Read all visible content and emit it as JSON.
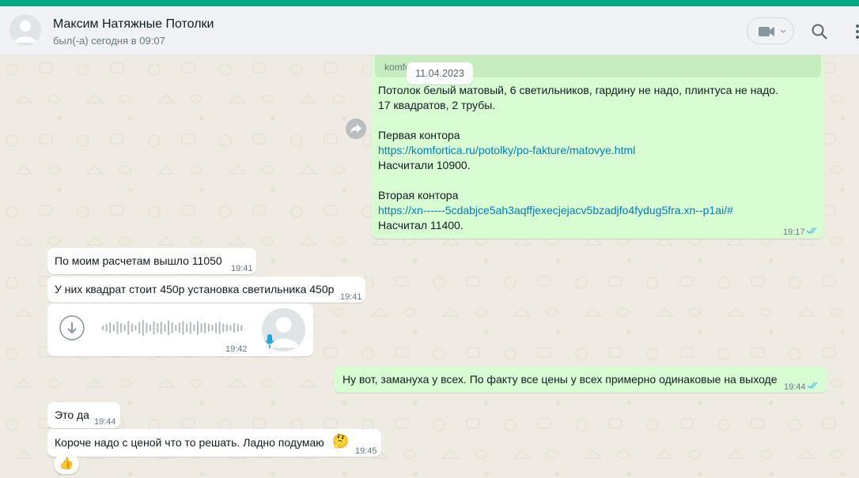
{
  "header": {
    "contact_name": "Максим Натяжные Потолки",
    "status": "был(-а) сегодня в 09:07"
  },
  "date_pill": "11.04.2023",
  "colors": {
    "accent": "#00a884",
    "outgoing_bubble": "#d9fdd3",
    "incoming_bubble": "#ffffff",
    "link": "#027eb5",
    "read_ticks": "#53bdeb"
  },
  "messages": {
    "big": {
      "quote": "komfo",
      "lines": [
        "Потолок белый матовый, 6 светильников, гардину не надо, плинтуса не надо.",
        "17 квадратов, 2 трубы.",
        "",
        "Первая контора",
        "https://komfortica.ru/potolky/po-fakture/matovye.html",
        "Насчитали 10900.",
        "",
        "Вторая контора",
        "https://xn------5cdabjce5ah3aqffjexecjejacv5bzadjfo4fydug5fra.xn--p1ai/#",
        "Насчитал 11400."
      ],
      "time": "19:17"
    },
    "m1": {
      "text": "По моим расчетам вышло 11050",
      "time": "19:41"
    },
    "m2": {
      "text": "У них квадрат стоит 450р установка светильника 450р",
      "time": "19:41"
    },
    "audio": {
      "time": "19:42",
      "waveform": [
        6,
        10,
        14,
        9,
        16,
        12,
        8,
        18,
        11,
        7,
        15,
        20,
        13,
        9,
        17,
        12,
        16,
        10,
        19,
        14,
        8,
        13,
        18,
        11,
        15,
        9,
        17,
        12,
        14,
        10,
        8,
        13,
        16,
        11,
        9,
        7,
        12,
        10,
        8
      ]
    },
    "m3": {
      "text": "Ну вот, замануха у всех. По факту все цены у всех примерно одинаковые на выходе",
      "time": "19:44"
    },
    "m4": {
      "text": "Это да",
      "time": "19:44"
    },
    "m5": {
      "text": "Короче надо с ценой что то решать. Ладно подумаю",
      "emoji": "🤔",
      "time": "19:45"
    },
    "reaction": "👍"
  }
}
